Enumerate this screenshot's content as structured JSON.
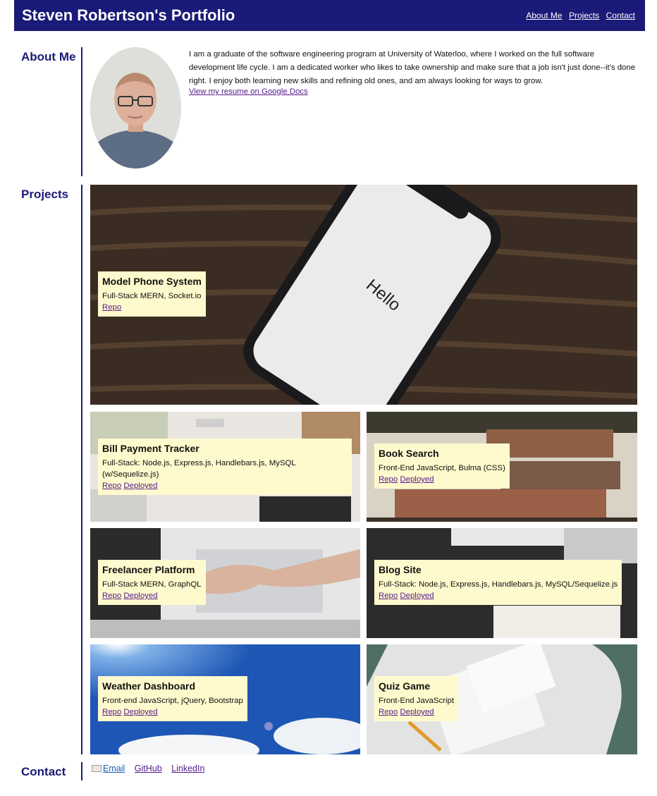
{
  "header": {
    "title": "Steven Robertson's Portfolio",
    "nav": [
      "About Me",
      "Projects",
      "Contact"
    ]
  },
  "about": {
    "title": "About Me",
    "text": "I am a graduate of the software engineering program at University of Waterloo, where I worked on the full software development life cycle. I am a dedicated worker who likes to take ownership and make sure that a job isn't just done--it's done right. I enjoy both learning new skills and refining old ones, and am always looking for ways to grow.",
    "resume_link": "View my resume on Google Docs"
  },
  "projects": {
    "title": "Projects",
    "items": [
      {
        "name": "Model Phone System",
        "tech": "Full-Stack MERN, Socket.io",
        "repo": "Repo",
        "deployed": ""
      },
      {
        "name": "Bill Payment Tracker",
        "tech": "Full-Stack: Node.js, Express.js, Handlebars.js, MySQL (w/Sequelize.js)",
        "repo": "Repo",
        "deployed": "Deployed"
      },
      {
        "name": "Book Search",
        "tech": "Front-End JavaScript, Bulma (CSS)",
        "repo": "Repo",
        "deployed": "Deployed"
      },
      {
        "name": "Freelancer Platform",
        "tech": "Full-Stack MERN, GraphQL",
        "repo": "Repo",
        "deployed": "Deployed"
      },
      {
        "name": "Blog Site",
        "tech": "Full-Stack: Node.js, Express.js, Handlebars.js, MySQL/Sequelize.js",
        "repo": "Repo",
        "deployed": "Deployed"
      },
      {
        "name": "Weather Dashboard",
        "tech": "Front-end JavaScript, jQuery, Bootstrap",
        "repo": "Repo",
        "deployed": "Deployed"
      },
      {
        "name": "Quiz Game",
        "tech": "Front-End JavaScript",
        "repo": "Repo",
        "deployed": "Deployed"
      }
    ],
    "images": [
      "phone-hello-photo",
      "bills-calculator-photo",
      "bookshelf-photo",
      "handshake-laptop-photo",
      "desk-keyboard-notebook-photo",
      "blue-sky-sun-photo",
      "quiz-paper-pencil-photo"
    ],
    "phone_screen_text": "Hello"
  },
  "contact": {
    "title": "Contact",
    "links": [
      "Email",
      "GitHub",
      "LinkedIn"
    ]
  },
  "colors": {
    "header_bg": "#1a1a78",
    "accent": "#1a1a78",
    "card_label_bg": "#fffacd",
    "link": "#551a8b"
  }
}
